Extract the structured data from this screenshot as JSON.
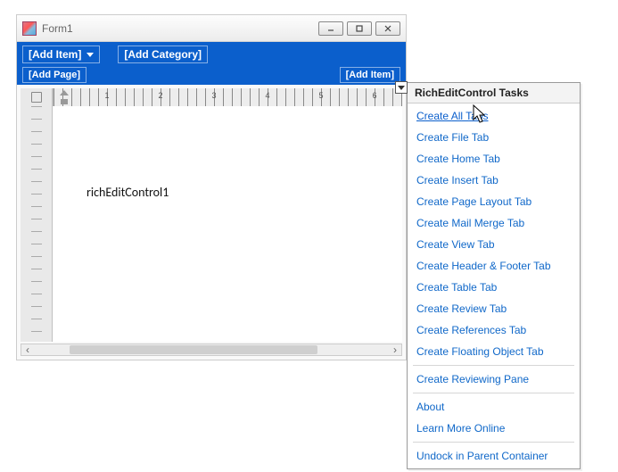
{
  "window": {
    "title": "Form1"
  },
  "ribbon": {
    "add_item_top": "[Add Item]",
    "add_category": "[Add Category]",
    "add_page": "[Add Page]",
    "add_item_right": "[Add Item]"
  },
  "ruler": {
    "numbers": [
      "1",
      "2",
      "3",
      "4",
      "5",
      "6"
    ]
  },
  "document": {
    "placeholder_text": "richEditControl1"
  },
  "smarttag": {
    "title": "RichEditControl Tasks",
    "groups": [
      [
        {
          "label": "Create All Tabs",
          "hovered": true
        },
        {
          "label": "Create File Tab"
        },
        {
          "label": "Create Home Tab"
        },
        {
          "label": "Create Insert Tab"
        },
        {
          "label": "Create Page Layout Tab"
        },
        {
          "label": "Create Mail Merge Tab"
        },
        {
          "label": "Create View Tab"
        },
        {
          "label": "Create Header & Footer Tab"
        },
        {
          "label": "Create Table Tab"
        },
        {
          "label": "Create Review Tab"
        },
        {
          "label": "Create References Tab"
        },
        {
          "label": "Create Floating Object Tab"
        }
      ],
      [
        {
          "label": "Create Reviewing Pane"
        }
      ],
      [
        {
          "label": "About"
        },
        {
          "label": "Learn More Online"
        }
      ],
      [
        {
          "label": "Undock in Parent Container"
        }
      ]
    ]
  }
}
